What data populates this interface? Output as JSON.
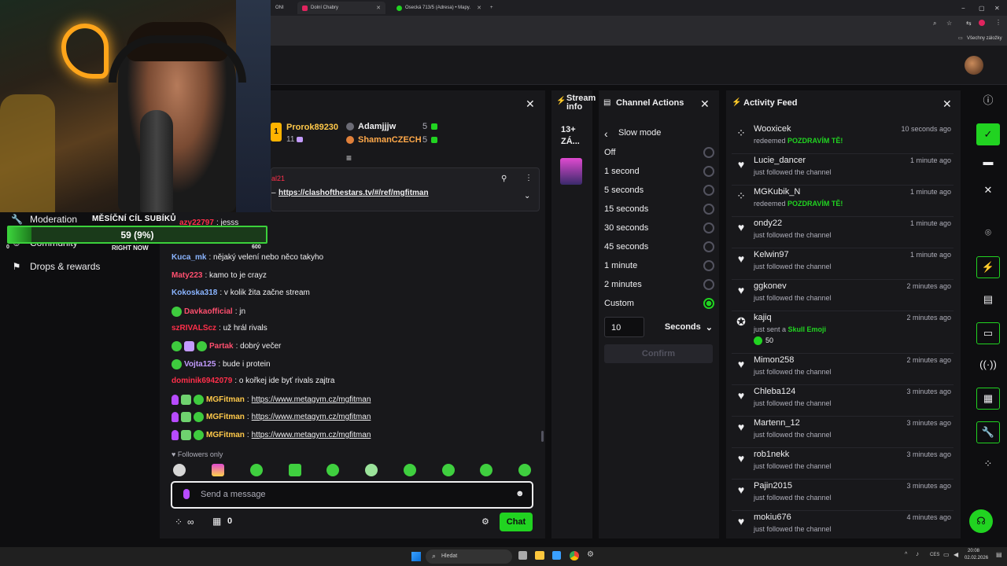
{
  "browser": {
    "tabs": [
      {
        "label": "Dolní Chabry",
        "color": "#e0245e"
      },
      {
        "label": "Osecká 713/5 (Adresa) • Mapy.",
        "color": "#21d321"
      }
    ],
    "partial_tab_label": "ONI",
    "bookmarks_label": "Všechny záložky"
  },
  "goal": {
    "title": "MĚSÍČNÍ CÍL SUBÍKŮ",
    "current_text": "59 (9%)",
    "progress_fraction": 0.09,
    "left_label": "0",
    "mid_label": "RIGHT NOW",
    "right_label": "600"
  },
  "left_nav": {
    "moderation": "Moderation",
    "community": "Community",
    "drops": "Drops & rewards"
  },
  "chat": {
    "leaderboard": [
      {
        "name": "Prorok89230",
        "count": "11",
        "rank": "1"
      },
      {
        "name": "Adamjjjw",
        "count": "5"
      },
      {
        "name": "ShamanCZECH",
        "count": "5"
      }
    ],
    "pinned_user": "al21",
    "pinned_link": "https://clashofthestars.tv/#/ref/mgfitman",
    "partial_first_user": "azy22797",
    "partial_first_text": ": jesss",
    "messages": [
      {
        "user": "Kuca_mk",
        "color": "#8ab4ff",
        "text": ": nějaký velení nebo něco takyho"
      },
      {
        "user": "Maty223",
        "color": "#ff4f6e",
        "text": ": kamo to je crayz"
      },
      {
        "user": "Kokoska318",
        "color": "#8ab4ff",
        "text": ": v kolik žita začne stream"
      },
      {
        "user": "Davkaofficial",
        "color": "#ff4f6e",
        "text": ": jn"
      },
      {
        "user": "szRIVALScz",
        "color": "#ff2f4a",
        "text": ": už hrál rivals"
      },
      {
        "user": "Partak",
        "color": "#ff4f6e",
        "text": ": dobrý večer"
      },
      {
        "user": "Vojta125",
        "color": "#c39bff",
        "text": ": bude i protein"
      },
      {
        "user": "dominik6942079",
        "color": "#ff2f4a",
        "text": ": o kořkej ide byť rivals zajtra"
      },
      {
        "user": "MGFitman",
        "color": "#ffc94a",
        "text": ": ",
        "link": "https://www.metagym.cz/mgfitman"
      },
      {
        "user": "MGFitman",
        "color": "#ffc94a",
        "text": ": ",
        "link": "https://www.metagym.cz/mgfitman"
      },
      {
        "user": "MGFitman",
        "color": "#ffc94a",
        "text": ": ",
        "link": "https://www.metagym.cz/mgfitman"
      }
    ],
    "followers_only": "Followers only",
    "input_placeholder": "Send a message",
    "points": "0",
    "chat_button": "Chat"
  },
  "stream_info": {
    "title": "Stream info",
    "age": "13+",
    "partial": "ZÁ..."
  },
  "channel_actions": {
    "title": "Channel Actions",
    "section": "Slow mode",
    "options": [
      "Off",
      "1 second",
      "5 seconds",
      "15 seconds",
      "30 seconds",
      "45 seconds",
      "1 minute",
      "2 minutes",
      "Custom"
    ],
    "selected": "Custom",
    "custom_value": "10",
    "unit": "Seconds",
    "confirm": "Confirm"
  },
  "activity_feed": {
    "title": "Activity Feed",
    "items": [
      {
        "name": "Wooxicek",
        "sub": "redeemed ",
        "highlight": "POZDRAVÍM TĚ!",
        "time": "10 seconds ago",
        "icon": "points-icon"
      },
      {
        "name": "Lucie_dancer",
        "sub": "just followed the channel",
        "time": "1 minute ago",
        "icon": "heart-icon"
      },
      {
        "name": "MGKubik_N",
        "sub": "redeemed ",
        "highlight": "POZDRAVÍM TĚ!",
        "time": "1 minute ago",
        "icon": "points-icon"
      },
      {
        "name": "ondy22",
        "sub": "just followed the channel",
        "time": "1 minute ago",
        "icon": "heart-icon"
      },
      {
        "name": "Kelwin97",
        "sub": "just followed the channel",
        "time": "1 minute ago",
        "icon": "heart-icon"
      },
      {
        "name": "ggkonev",
        "sub": "just followed the channel",
        "time": "2 minutes ago",
        "icon": "heart-icon"
      },
      {
        "name": "kajiq",
        "sub": "just sent a ",
        "highlight": "Skull Emoji",
        "extra": "50",
        "time": "2 minutes ago",
        "icon": "bits-icon"
      },
      {
        "name": "Mimon258",
        "sub": "just followed the channel",
        "time": "2 minutes ago",
        "icon": "heart-icon"
      },
      {
        "name": "Chleba124",
        "sub": "just followed the channel",
        "time": "3 minutes ago",
        "icon": "heart-icon"
      },
      {
        "name": "Martenn_12",
        "sub": "just followed the channel",
        "time": "3 minutes ago",
        "icon": "heart-icon"
      },
      {
        "name": "rob1nekk",
        "sub": "just followed the channel",
        "time": "3 minutes ago",
        "icon": "heart-icon"
      },
      {
        "name": "Pajin2015",
        "sub": "just followed the channel",
        "time": "3 minutes ago",
        "icon": "heart-icon"
      },
      {
        "name": "mokiu676",
        "sub": "just followed the channel",
        "time": "4 minutes ago",
        "icon": "heart-icon"
      }
    ]
  },
  "taskbar": {
    "search": "Hledat",
    "lang": "CES",
    "time": "20:08",
    "date": "02.02.2026"
  },
  "colors": {
    "accent": "#21d321",
    "panel": "#18181b",
    "background": "#0e0e10"
  }
}
